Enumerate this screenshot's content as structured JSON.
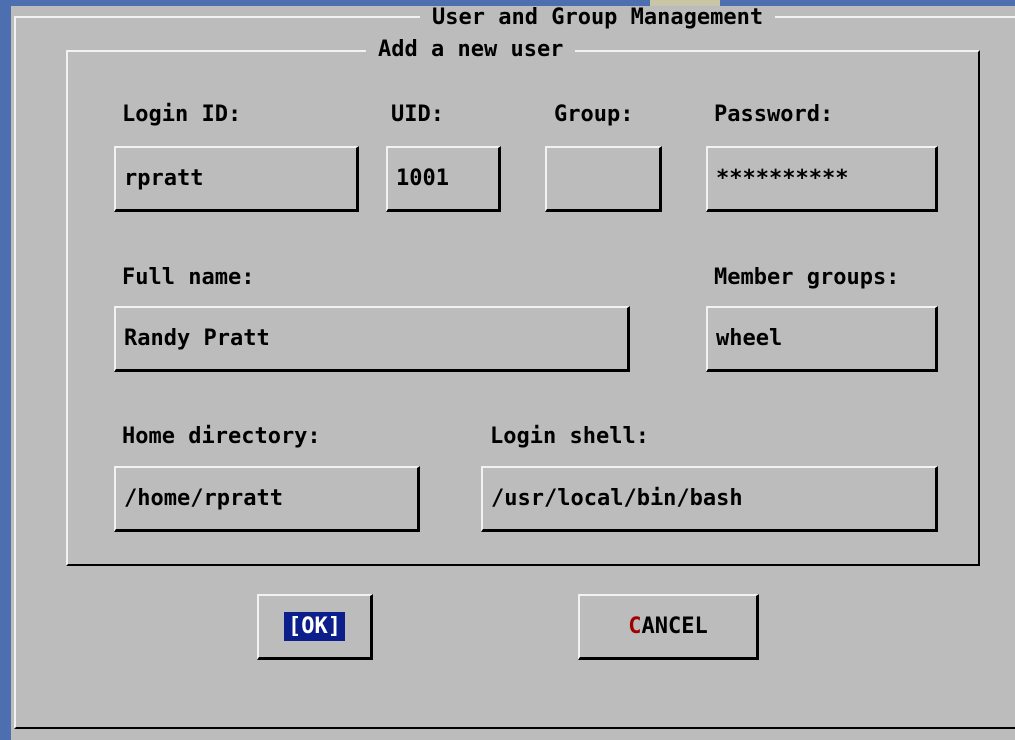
{
  "dialog": {
    "title": "User and Group Management",
    "section_title": "Add a new user"
  },
  "fields": {
    "login_id": {
      "label": "Login ID:",
      "value": "rpratt"
    },
    "uid": {
      "label": "UID:",
      "value": "1001"
    },
    "group": {
      "label": "Group:",
      "value": ""
    },
    "password": {
      "label": "Password:",
      "value": "**********"
    },
    "full_name": {
      "label": "Full name:",
      "value": "Randy Pratt"
    },
    "member_groups": {
      "label": "Member groups:",
      "value": "wheel"
    },
    "home_directory": {
      "label": "Home directory:",
      "value": "/home/rpratt"
    },
    "login_shell": {
      "label": "Login shell:",
      "value": "/usr/local/bin/bash"
    }
  },
  "buttons": {
    "ok_label": "[OK]",
    "cancel_hotkey": "C",
    "cancel_rest": "ANCEL"
  },
  "colors": {
    "dialog_bg": "#bcbcbc",
    "desktop": "#4d6fb0",
    "ok_highlight": "#0b1e8c",
    "hotkey": "#a00000"
  }
}
